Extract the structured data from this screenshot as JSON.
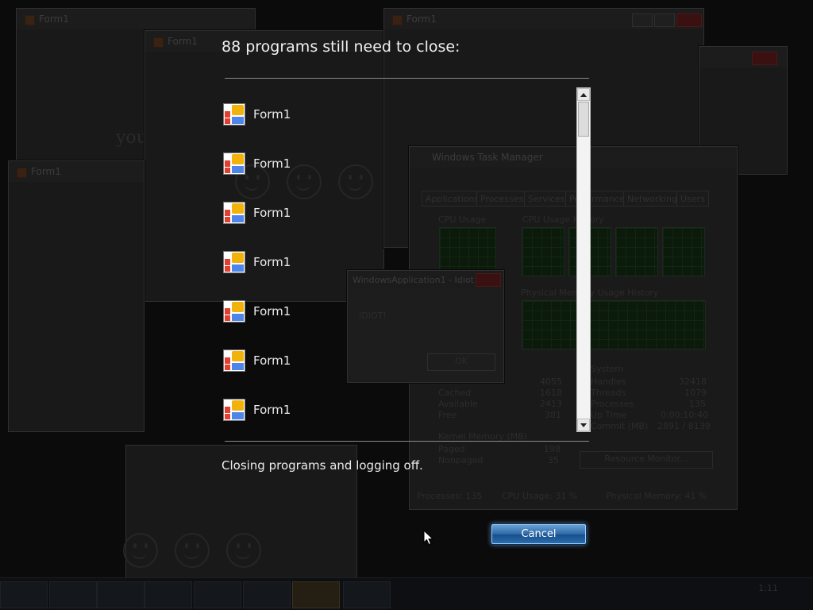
{
  "dialog": {
    "heading": "88 programs still need to close:",
    "status": "Closing programs and logging off.",
    "cancel_label": "Cancel"
  },
  "programs": [
    {
      "name": "Form1",
      "icon": "form-app-icon"
    },
    {
      "name": "Form1",
      "icon": "form-app-icon"
    },
    {
      "name": "Form1",
      "icon": "form-app-icon"
    },
    {
      "name": "Form1",
      "icon": "form-app-icon"
    },
    {
      "name": "Form1",
      "icon": "form-app-icon"
    },
    {
      "name": "Form1",
      "icon": "form-app-icon"
    },
    {
      "name": "Form1",
      "icon": "form-app-icon"
    }
  ],
  "background": {
    "window_title": "Form1",
    "you_text": "you",
    "task_manager": {
      "title": "Windows Task Manager",
      "tabs": [
        "Applications",
        "Processes",
        "Services",
        "Performance",
        "Networking",
        "Users"
      ],
      "labels": {
        "cpu_usage": "CPU Usage",
        "cpu_history": "CPU Usage History",
        "mem_history": "Physical Memory Usage History",
        "cached": "Cached",
        "available": "Available",
        "free": "Free",
        "kernel": "Kernel Memory (MB)",
        "paged": "Paged",
        "nonpaged": "Nonpaged",
        "system": "System",
        "handles": "Handles",
        "threads": "Threads",
        "processes": "Processes",
        "uptime": "Up Time",
        "commit": "Commit (MB)",
        "resource_monitor": "Resource Monitor..."
      },
      "values": {
        "total": "4055",
        "cached": "1618",
        "available": "2413",
        "free": "381",
        "paged": "198",
        "nonpaged": "35",
        "handles": "32418",
        "threads": "1079",
        "processes": "135",
        "uptime": "0:00:10:40",
        "commit": "2891 / 8139"
      },
      "status": {
        "processes": "Processes: 135",
        "cpu": "CPU Usage: 31 %",
        "memory": "Physical Memory: 41 %"
      }
    },
    "msgbox": {
      "title": "WindowsApplication1 - Idiot",
      "text": "IDIOT!",
      "ok": "OK"
    },
    "clock": "1:11"
  }
}
